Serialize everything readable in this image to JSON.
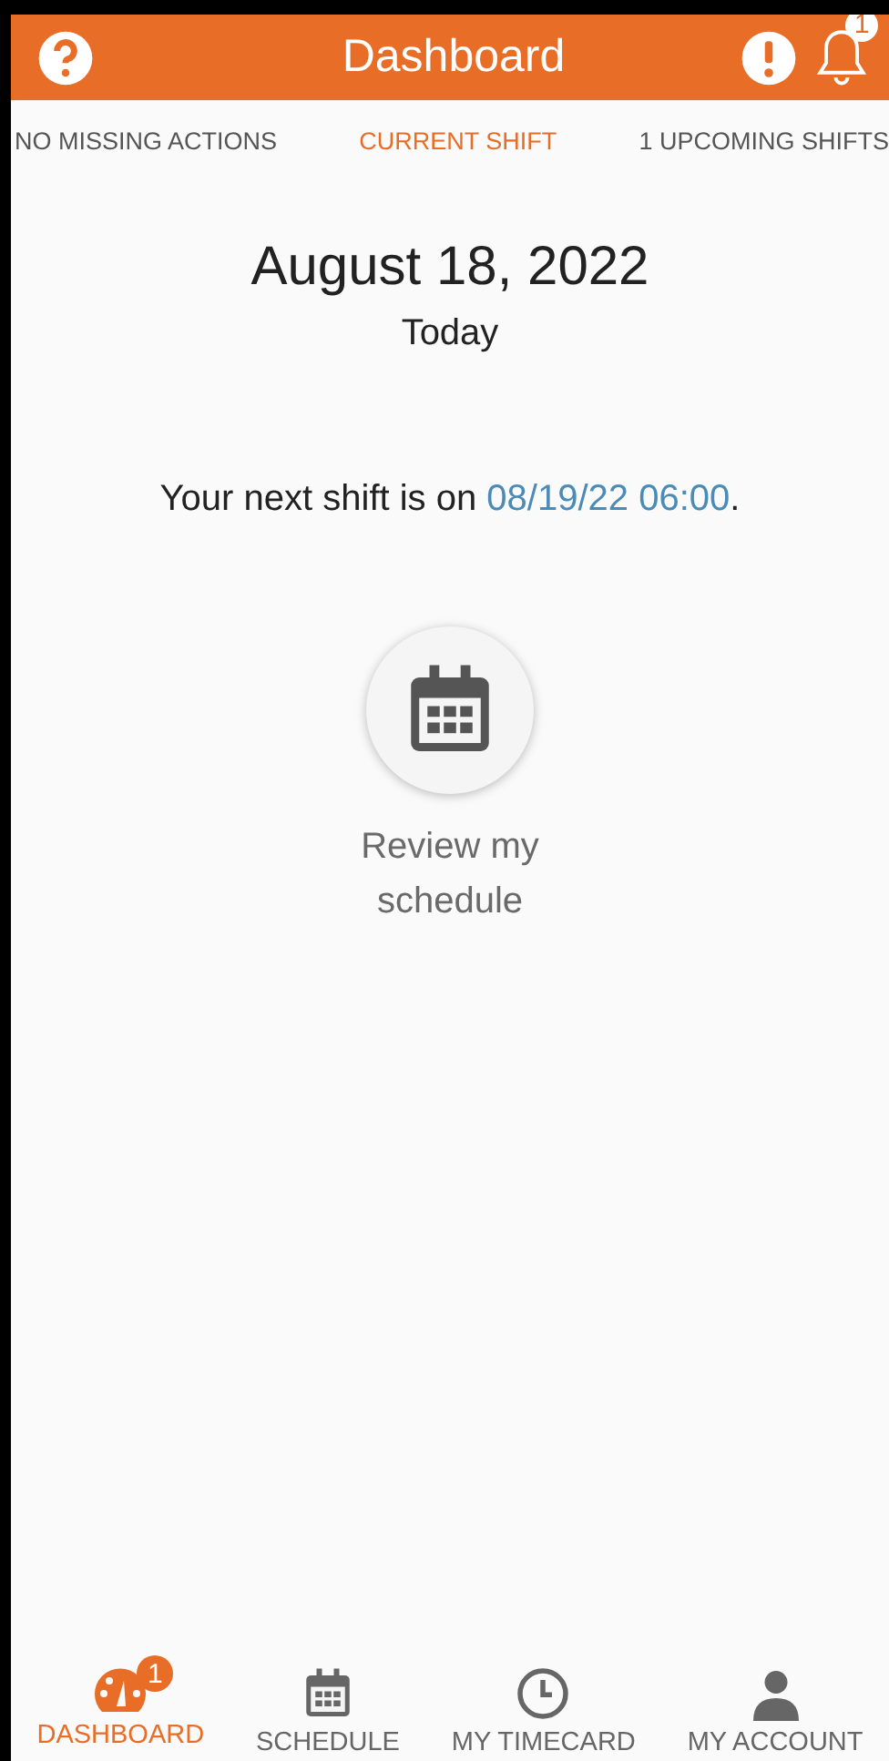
{
  "header": {
    "title": "Dashboard",
    "notification_count": "1"
  },
  "tabs": [
    {
      "label": "NO MISSING ACTIONS",
      "selected": false
    },
    {
      "label": "CURRENT SHIFT",
      "selected": true
    },
    {
      "label": "1 UPCOMING SHIFTS",
      "selected": false
    }
  ],
  "date": "August 18, 2022",
  "day": "Today",
  "next_shift": {
    "text": "Your next shift is on ",
    "link": "08/19/22 06:00",
    "end": "."
  },
  "action": {
    "label": "Review my schedule"
  },
  "nav": [
    {
      "kind": "dashboard",
      "label": "DASHBOARD",
      "selected": true,
      "badge": "1"
    },
    {
      "kind": "schedule",
      "label": "SCHEDULE",
      "selected": false
    },
    {
      "kind": "timecard",
      "label": "MY TIMECARD",
      "selected": false
    },
    {
      "kind": "account",
      "label": "MY ACCOUNT",
      "selected": false
    }
  ]
}
